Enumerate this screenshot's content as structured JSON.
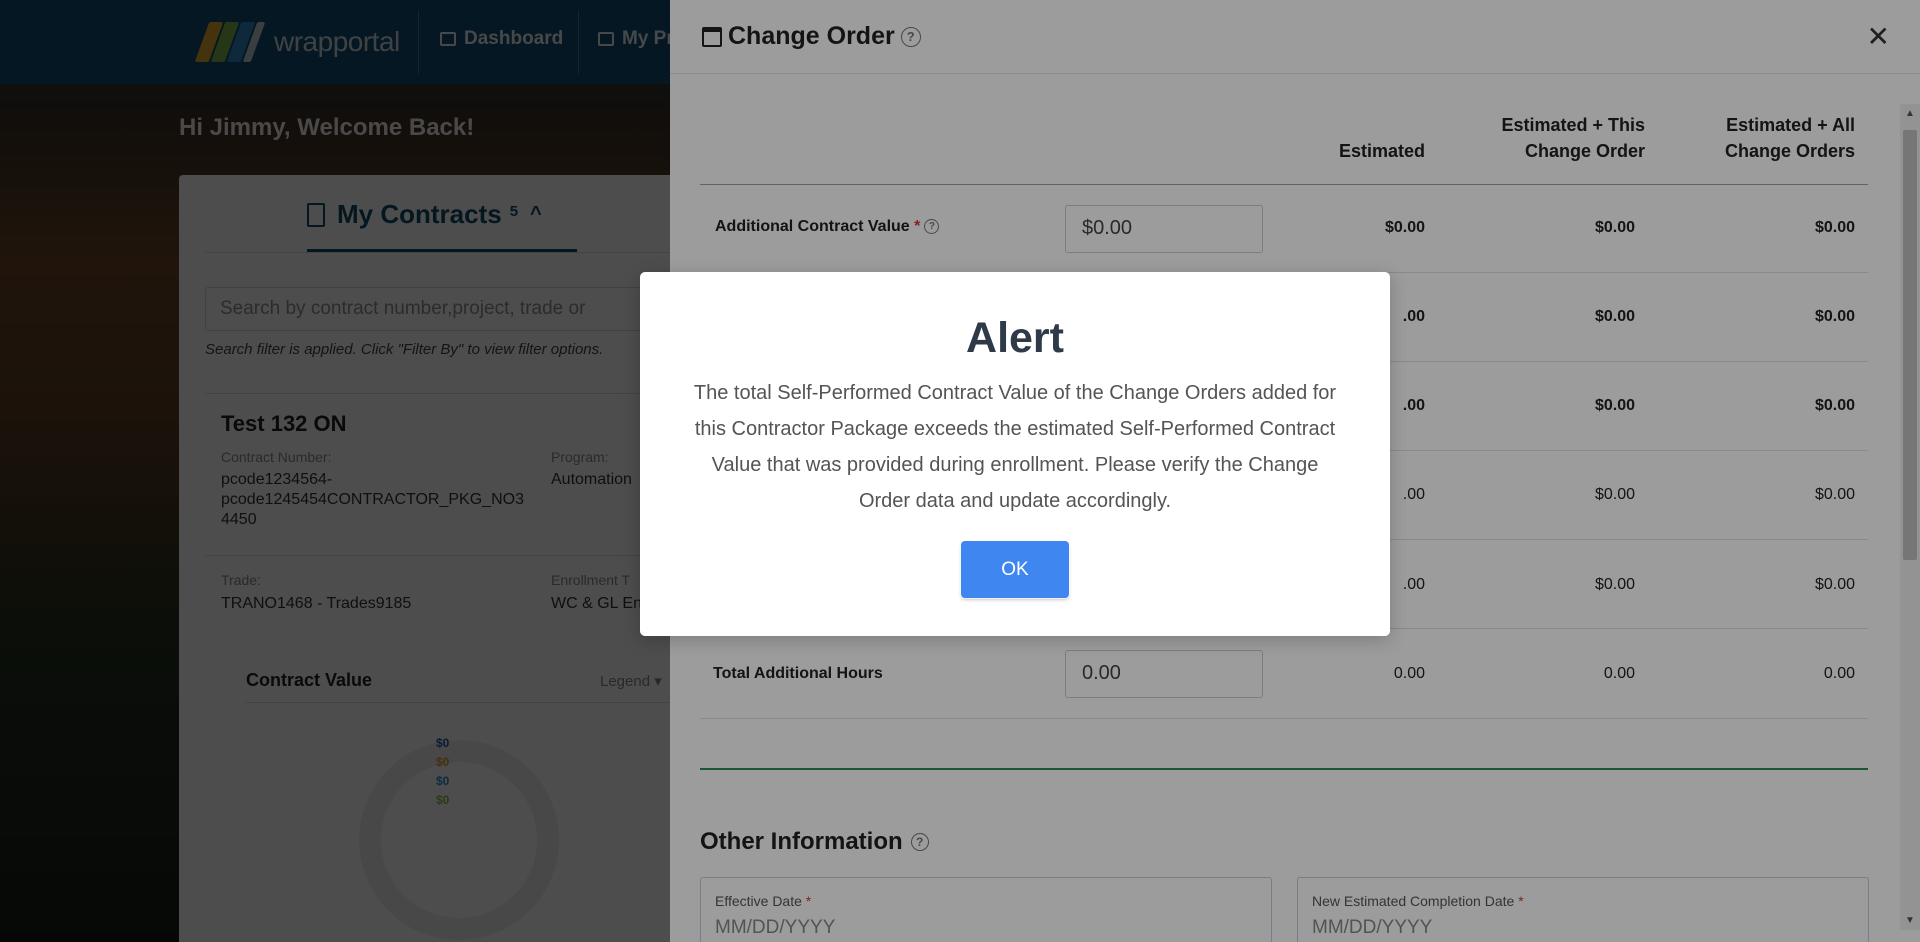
{
  "nav": {
    "logo_text": "wrapportal",
    "items": [
      {
        "label": "Dashboard"
      },
      {
        "label": "My Pr"
      }
    ]
  },
  "welcome": "Hi Jimmy, Welcome Back!",
  "contracts": {
    "tab_label": "My Contracts",
    "count": "5",
    "search_placeholder": "Search by contract number,project, trade or",
    "filter_note": "Search filter is applied. Click \"Filter By\" to view filter options.",
    "card": {
      "title": "Test 132 ON",
      "contract_number_label": "Contract Number:",
      "contract_number_value": "pcode1234564-\npcode1245454CONTRACTOR_PKG_NO3\n4450",
      "program_label": "Program:",
      "program_value": "Automation",
      "trade_label": "Trade:",
      "trade_value": "TRANO1468 - Trades9185",
      "enrollment_label": "Enrollment T",
      "enrollment_value": "WC & GL En",
      "contract_value_title": "Contract Value",
      "legend_label": "Legend",
      "donut_values": [
        "$0",
        "$0",
        "$0",
        "$0"
      ]
    }
  },
  "change_order": {
    "title": "Change Order",
    "columns": [
      "Estimated",
      "Estimated + This Change Order",
      "Estimated + All Change Orders"
    ],
    "col_head": {
      "c1": "Estimated",
      "c2a": "Estimated + This",
      "c2b": "Change Order",
      "c3a": "Estimated + All",
      "c3b": "Change Orders"
    },
    "rows": [
      {
        "label": "Additional Contract Value",
        "input": "$0.00",
        "estimated": "$0.00",
        "this_co": "$0.00",
        "all_co": "$0.00"
      },
      {
        "label": "",
        "input": "",
        "estimated": ".00",
        "this_co": "$0.00",
        "all_co": "$0.00"
      },
      {
        "label": "",
        "input": "",
        "estimated": ".00",
        "this_co": "$0.00",
        "all_co": "$0.00"
      },
      {
        "label": "",
        "input": "",
        "estimated": ".00",
        "this_co": "$0.00",
        "all_co": "$0.00"
      },
      {
        "label": "",
        "input": "",
        "estimated": ".00",
        "this_co": "$0.00",
        "all_co": "$0.00"
      },
      {
        "label": "Total Additional Hours",
        "input": "0.00",
        "estimated": "0.00",
        "this_co": "0.00",
        "all_co": "0.00"
      }
    ],
    "other_info_title": "Other Information",
    "effective_date_label": "Effective Date",
    "effective_date_placeholder": "MM/DD/YYYY",
    "completion_date_label": "New Estimated Completion Date",
    "completion_date_placeholder": "MM/DD/YYYY",
    "required_mark": "*"
  },
  "alert": {
    "title": "Alert",
    "message": "The total Self-Performed Contract Value of the Change Orders added for this Contractor Package exceeds the estimated Self-Performed Contract Value that was provided during enrollment. Please verify the Change Order data and update accordingly.",
    "ok_label": "OK"
  },
  "colors": {
    "nav_bg": "#0e4f73",
    "primary": "#3f86f0",
    "section_rule": "#2e8c52",
    "required": "#d43b3b",
    "donut_colors": [
      "#1f5fae",
      "#e39b2d",
      "#2a8fcf",
      "#8fbf4a"
    ]
  }
}
